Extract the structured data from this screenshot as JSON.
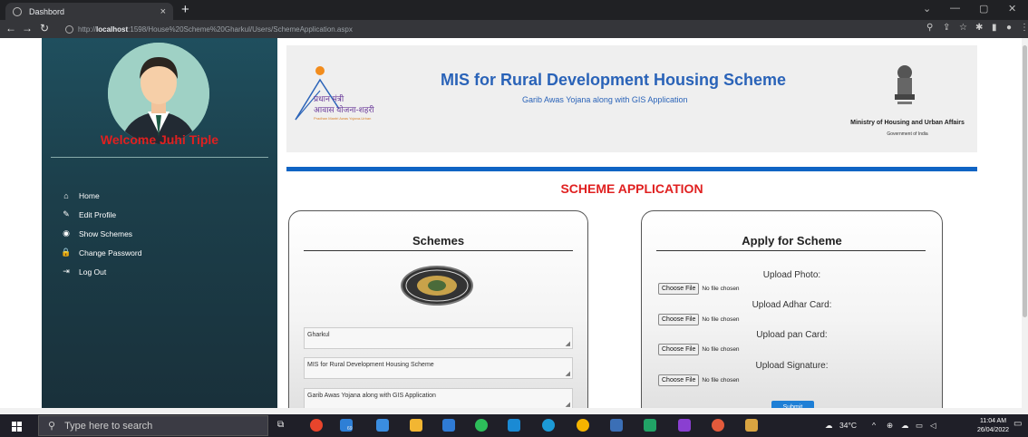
{
  "browser": {
    "tab_title": "Dashbord",
    "tab_close": "×",
    "new_tab": "+",
    "url_prefix": "http://",
    "url_host": "localhost",
    "url_rest": ":1598/House%20Scheme%20Gharkul/Users/SchemeApplication.aspx"
  },
  "sidebar": {
    "welcome": "Welcome Juhi Tiple",
    "items": [
      {
        "icon": "home-icon",
        "glyph": "⌂",
        "label": "Home"
      },
      {
        "icon": "edit-icon",
        "glyph": "✎",
        "label": "Edit Profile"
      },
      {
        "icon": "eye-icon",
        "glyph": "◉",
        "label": "Show Schemes"
      },
      {
        "icon": "lock-icon",
        "glyph": "🔒",
        "label": "Change Password"
      },
      {
        "icon": "logout-icon",
        "glyph": "⇥",
        "label": "Log Out"
      }
    ]
  },
  "header": {
    "logo_hindi_1": "प्रधान मंत्री",
    "logo_hindi_2": "आवास योजना-शहरी",
    "logo_english": "Pradhan Mantri Awas Yojana-Urban",
    "title": "MIS for Rural Development Housing Scheme",
    "subtitle": "Garib Awas Yojana along with GIS Application",
    "ministry": "Ministry of Housing and Urban Affairs",
    "government": "Government of India"
  },
  "main": {
    "page_title": "SCHEME APPLICATION",
    "schemes_panel": {
      "title": "Schemes",
      "fields": [
        "Gharkul",
        "MIS for Rural Development Housing Scheme",
        "Garib Awas Yojana along with GIS Application"
      ]
    },
    "apply_panel": {
      "title": "Apply for Scheme",
      "uploads": [
        {
          "label": "Upload Photo:",
          "button": "Choose File",
          "status": "No file chosen"
        },
        {
          "label": "Upload Adhar Card:",
          "button": "Choose File",
          "status": "No file chosen"
        },
        {
          "label": "Upload pan Card:",
          "button": "Choose File",
          "status": "No file chosen"
        },
        {
          "label": "Upload Signature:",
          "button": "Choose File",
          "status": "No file chosen"
        }
      ],
      "submit_label": "Submit"
    }
  },
  "taskbar": {
    "search_placeholder": "Type here to search",
    "temperature": "34°C",
    "time": "11:04 AM",
    "date": "26/04/2022",
    "badge": "69"
  },
  "colors": {
    "sidebar": "#1f4f5e",
    "welcome": "#e02020",
    "header_title": "#2a63b8",
    "accent_bar": "#1064c4",
    "submit": "#1e7fd6"
  }
}
